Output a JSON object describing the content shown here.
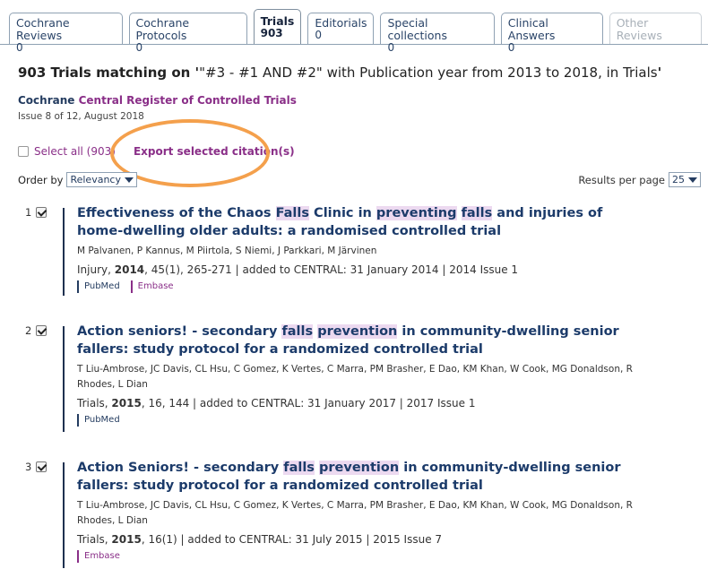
{
  "tabs": [
    {
      "label": "Cochrane Reviews",
      "count": "0"
    },
    {
      "label": "Cochrane Protocols",
      "count": "0"
    },
    {
      "label": "Trials",
      "count": "903"
    },
    {
      "label": "Editorials",
      "count": "0"
    },
    {
      "label": "Special collections",
      "count": "0"
    },
    {
      "label": "Clinical Answers",
      "count": "0"
    },
    {
      "label": "Other Reviews",
      "count": ""
    }
  ],
  "heading": {
    "prefix": "903 Trials matching on '",
    "query": "\"#3 - #1 AND #2\" with Publication year from 2013 to 2018, in Trials",
    "suffix": "'"
  },
  "database": {
    "brand": "Cochrane",
    "name": "Central Register of Controlled Trials",
    "issue": "Issue 8 of 12, August 2018"
  },
  "selection": {
    "select_all": "Select all (903)",
    "export": "Export selected citation(s)"
  },
  "ordering": {
    "order_label": "Order by",
    "order_value": "Relevancy",
    "per_page_label": "Results per page",
    "per_page_value": "25"
  },
  "colors": {
    "accent_purple": "#8a2f88",
    "navy": "#1c3b6a",
    "highlight": "#ecd9f0",
    "annotation_ring": "#f4a04c"
  },
  "results": [
    {
      "number": "1",
      "title": [
        {
          "t": "Effectiveness of the Chaos "
        },
        {
          "t": "Falls",
          "hl": true
        },
        {
          "t": " Clinic in "
        },
        {
          "t": "preventing",
          "hl": true
        },
        {
          "t": " "
        },
        {
          "t": "falls",
          "hl": true
        },
        {
          "t": " and injuries of home-dwelling older adults: a randomised controlled trial"
        }
      ],
      "authors": "M Palvanen, P Kannus, M Piirtola, S Niemi, J Parkkari, M Järvinen",
      "journal": "Injury, ",
      "year": "2014",
      "details": ", 45(1), 265-271 | added to CENTRAL: 31 January 2014 | 2014 Issue 1",
      "badges": [
        "PubMed",
        "Embase"
      ]
    },
    {
      "number": "2",
      "title": [
        {
          "t": "Action seniors! - secondary "
        },
        {
          "t": "falls",
          "hl": true
        },
        {
          "t": " "
        },
        {
          "t": "prevention",
          "hl": true
        },
        {
          "t": " in community-dwelling senior fallers: study protocol for a randomized controlled trial"
        }
      ],
      "authors": "T Liu-Ambrose, JC Davis, CL Hsu, C Gomez, K Vertes, C Marra, PM Brasher, E Dao, KM Khan, W Cook, MG Donaldson, R Rhodes, L Dian",
      "journal": "Trials, ",
      "year": "2015",
      "details": ", 16, 144 | added to CENTRAL: 31 January 2017 | 2017 Issue 1",
      "badges": [
        "PubMed"
      ]
    },
    {
      "number": "3",
      "title": [
        {
          "t": "Action Seniors! - secondary "
        },
        {
          "t": "falls",
          "hl": true
        },
        {
          "t": " "
        },
        {
          "t": "prevention",
          "hl": true
        },
        {
          "t": " in community-dwelling senior fallers: study protocol for a randomized controlled trial"
        }
      ],
      "authors": "T Liu-Ambrose, JC Davis, CL Hsu, C Gomez, K Vertes, C Marra, PM Brasher, E Dao, KM Khan, W Cook, MG Donaldson, R Rhodes, L Dian",
      "journal": "Trials, ",
      "year": "2015",
      "details": ", 16(1) | added to CENTRAL: 31 July 2015 | 2015 Issue 7",
      "badges": [
        "Embase"
      ]
    }
  ]
}
